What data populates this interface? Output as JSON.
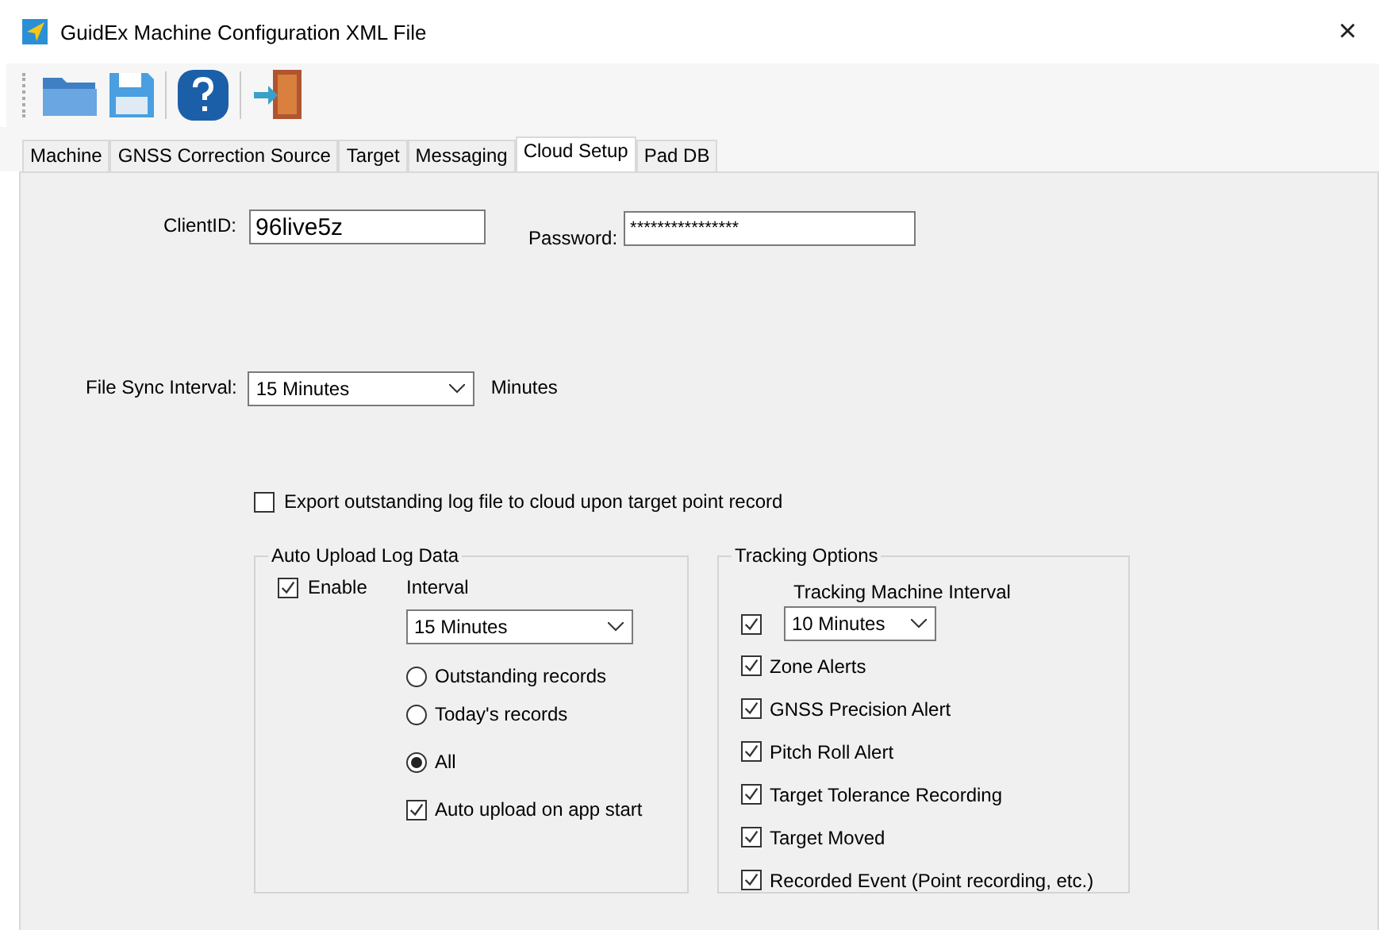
{
  "window": {
    "title": "GuidEx Machine Configuration XML File",
    "close": "×"
  },
  "tabs": [
    {
      "label": "Machine",
      "selected": false
    },
    {
      "label": "GNSS Correction Source",
      "selected": false
    },
    {
      "label": "Target",
      "selected": false
    },
    {
      "label": "Messaging",
      "selected": false
    },
    {
      "label": "Cloud Setup",
      "selected": true
    },
    {
      "label": "Pad DB",
      "selected": false
    }
  ],
  "client_id": {
    "label": "ClientID:",
    "value": "96live5z"
  },
  "password": {
    "label": "Password:",
    "value": "****************"
  },
  "file_sync": {
    "label": "File Sync Interval:",
    "value": "15 Minutes",
    "unit": "Minutes"
  },
  "export_log": {
    "label": "Export outstanding log file to cloud upon target point record",
    "checked": false
  },
  "auto_upload": {
    "title": "Auto Upload Log Data",
    "enable": {
      "label": "Enable",
      "checked": true
    },
    "interval_label": "Interval",
    "interval": "15 Minutes",
    "options": [
      {
        "label": "Outstanding records",
        "selected": false
      },
      {
        "label": "Today's records",
        "selected": false
      },
      {
        "label": "All",
        "selected": true
      }
    ],
    "on_start": {
      "label": "Auto upload on app start",
      "checked": true
    }
  },
  "tracking": {
    "title": "Tracking Options",
    "interval_label": "Tracking Machine Interval",
    "interval_checked": true,
    "interval": "10 Minutes",
    "options": [
      {
        "label": "Zone Alerts",
        "checked": true
      },
      {
        "label": "GNSS Precision Alert",
        "checked": true
      },
      {
        "label": "Pitch Roll Alert",
        "checked": true
      },
      {
        "label": "Target Tolerance Recording",
        "checked": true
      },
      {
        "label": "Target Moved",
        "checked": true
      },
      {
        "label": "Recorded Event (Point recording, etc.)",
        "checked": true
      }
    ]
  }
}
